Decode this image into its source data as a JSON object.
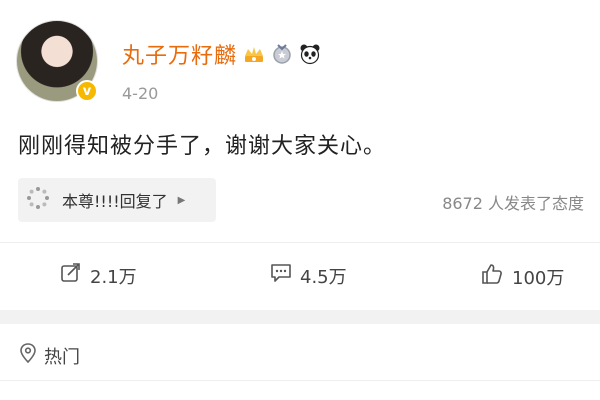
{
  "post": {
    "username": "丸子万籽麟",
    "time": "4-20",
    "content": "刚刚得知被分手了，谢谢大家关心。",
    "verified_symbol": "v",
    "badges": [
      "crown-badge-icon",
      "medal-badge-icon",
      "panda-badge-icon"
    ]
  },
  "reply": {
    "text": "本尊!!!!回复了",
    "arrow": "▶"
  },
  "attitude": {
    "text": "8672 人发表了态度"
  },
  "actions": {
    "repost_count": "2.1万",
    "comment_count": "4.5万",
    "like_count": "100万"
  },
  "hot": {
    "label": "热门"
  },
  "colors": {
    "username": "#e86b0c",
    "verified": "#f6b800",
    "separator": "#f2f2f2"
  }
}
